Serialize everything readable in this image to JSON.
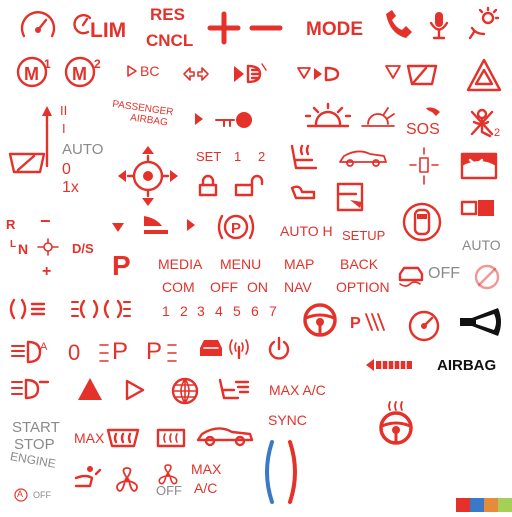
{
  "colors": {
    "primary": "#e4322b",
    "muted": "#8a8a8a",
    "dark": "#111111",
    "blue": "#3a78c8"
  },
  "labels": {
    "lim": "LIM",
    "res": "RES",
    "cncl": "CNCL",
    "mode": "MODE",
    "m1_sup": "1",
    "m2_sup": "2",
    "bc": "BC",
    "passenger": "PASSENGER",
    "airbag_small": "AIRBAG",
    "sos": "SOS",
    "kid_sub": "2",
    "ii": "II",
    "i": "I",
    "auto_wiper": "AUTO",
    "zero_wiper": "0",
    "one_x": "1x",
    "set": "SET",
    "set_1": "1",
    "set_2": "2",
    "gear_r": "R",
    "gear_n": "N",
    "gear_l": "L",
    "gear_ds": "D/S",
    "gear_minus": "−",
    "gear_plus": "+",
    "brake_p": "P",
    "auto_h": "AUTO H",
    "setup": "SETUP",
    "auto_climate": "AUTO",
    "park_p": "P",
    "media": "MEDIA",
    "menu": "MENU",
    "map": "MAP",
    "back": "BACK",
    "com": "COM",
    "off": "OFF",
    "on": "ON",
    "nav": "NAV",
    "option": "OPTION",
    "esp_off": "OFF",
    "num_1": "1",
    "num_2": "2",
    "num_3": "3",
    "num_4": "4",
    "num_5": "5",
    "num_6": "6",
    "num_7": "7",
    "zero_big": "0",
    "p_big1": "P",
    "p_big2": "P",
    "airbag_big": "AIRBAG",
    "max_ac": "MAX A/C",
    "sync": "SYNC",
    "start": "START",
    "stop": "STOP",
    "engine": "ENGINE",
    "max": "MAX",
    "fan_off": "OFF",
    "max_ac2_1": "MAX",
    "max_ac2_2": "A/C",
    "auto_off_a": "A",
    "auto_off": "OFF"
  },
  "icons": [
    "speedometer-icon",
    "speed-limit-icon",
    "plus-icon",
    "minus-icon",
    "phone-hangup-icon",
    "microphone-icon",
    "light-sensor-icon",
    "memory-1-icon",
    "memory-2-icon",
    "bc-icon",
    "rear-left-right-icon",
    "fog-light-icon",
    "lane-assist-icon",
    "rear-wiper-icon",
    "hazard-icon",
    "wiper-stalk-icon",
    "passenger-airbag-icon",
    "key-icon",
    "sunrise-icon",
    "dim-icon",
    "sos-phone-icon",
    "child-seat-icon",
    "front-wiper-icon",
    "steering-adjust-icon",
    "seat-heat-icon",
    "car-side-icon",
    "sensor-cross-icon",
    "window-icon",
    "lock-icon",
    "unlock-icon",
    "trunk-icon",
    "door-open-icon",
    "tow-camera-icon",
    "gear-selector-icon",
    "arrow-down-icon",
    "high-beam-icon",
    "arrow-right-icon",
    "parking-brake-icon",
    "car-top-icon",
    "skid-off-icon",
    "fog-front-icon",
    "parking-light-icon",
    "steering-wheel-icon",
    "speed-warn-icon",
    "horn-icon",
    "auto-light-icon",
    "low-beam-icon",
    "pedestrian-car-icon",
    "wifi-car-icon",
    "power-icon",
    "seatbelt-bar-icon",
    "headlight-icon",
    "triangle-fill-icon",
    "play-icon",
    "globe-icon",
    "seat-airflow-icon",
    "max-defrost-icon",
    "rear-defrost-icon",
    "car-outline-icon",
    "heated-wheel-icon",
    "seat-vent-icon",
    "fan-icon",
    "fan-off-icon",
    "color-swatch-icon"
  ]
}
